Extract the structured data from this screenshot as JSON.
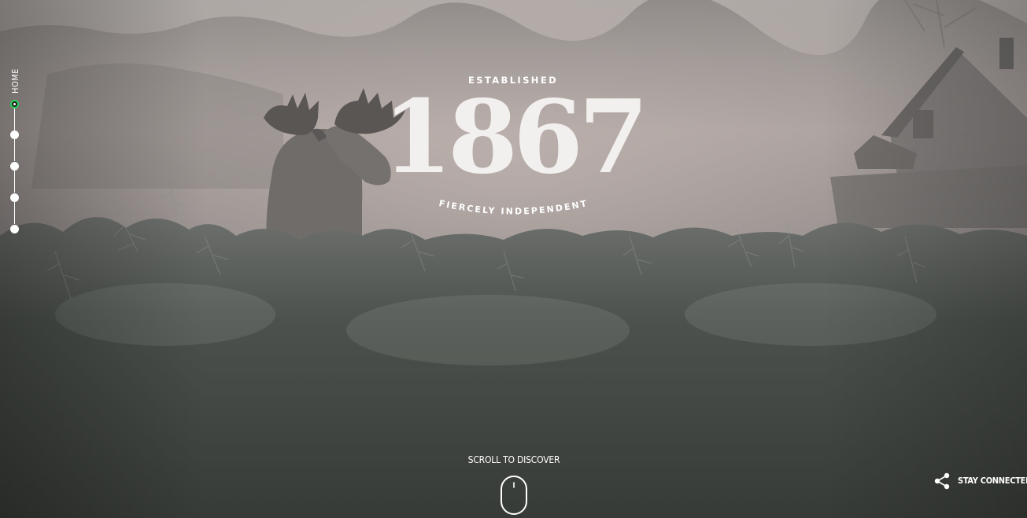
{
  "side_nav": {
    "label": "HOME",
    "sections": 5,
    "active_index": 0
  },
  "hero": {
    "established": "ESTABLISHED",
    "year": "1867",
    "tagline": "FIERCELY INDEPENDENT"
  },
  "scroll_cue": {
    "label": "SCROLL TO DISCOVER"
  },
  "footer": {
    "stay_connected": "STAY CONNECTED"
  },
  "colors": {
    "active_dot_ring": "#2ad15a",
    "text": "#ffffff",
    "year_text": "#f2f0ef"
  },
  "icons": [
    "mouse-scroll-icon",
    "share-icon"
  ]
}
